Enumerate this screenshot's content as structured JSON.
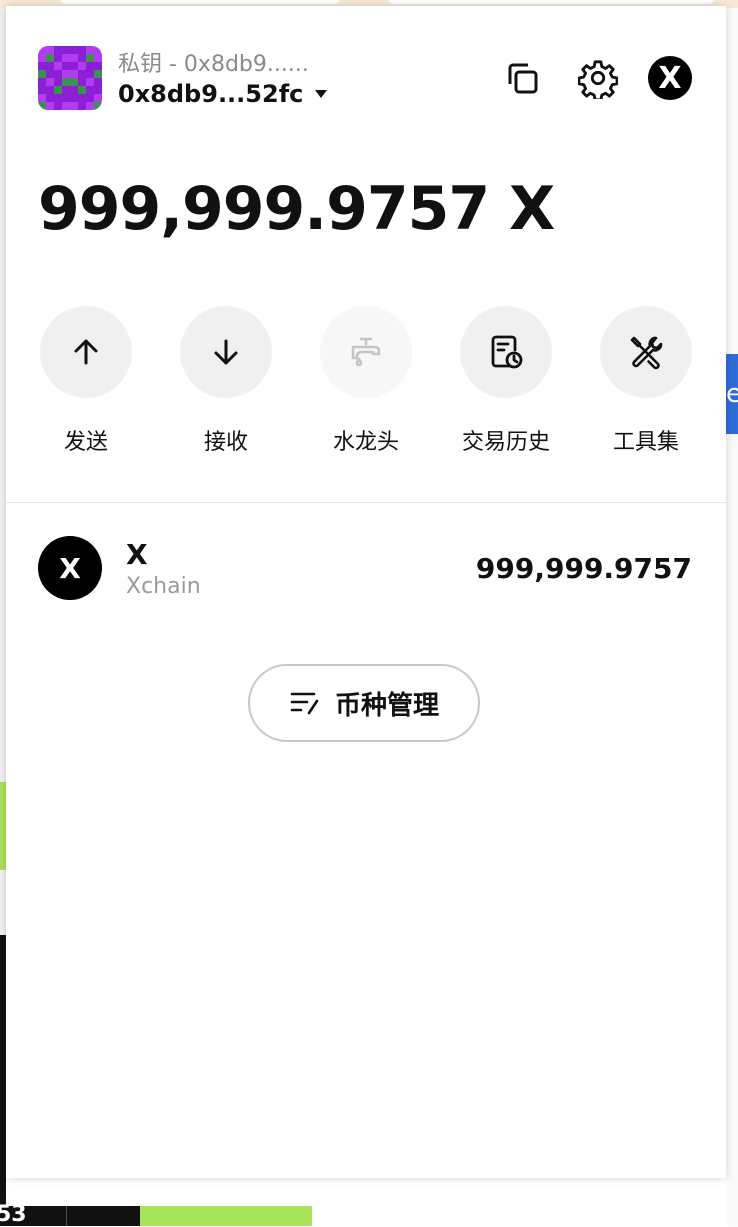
{
  "account": {
    "subtitle": "私钥 - 0x8db9......",
    "address": "0x8db9...52fc"
  },
  "header_icons": [
    "copy-icon",
    "gear-icon",
    "x-logo-icon"
  ],
  "logo_letter": "X",
  "balance": {
    "text": "999,999.9757 X"
  },
  "actions": [
    {
      "label": "发送",
      "icon": "arrow-up-icon"
    },
    {
      "label": "接收",
      "icon": "arrow-down-icon"
    },
    {
      "label": "水龙头",
      "icon": "faucet-icon"
    },
    {
      "label": "交易历史",
      "icon": "history-icon"
    },
    {
      "label": "工具集",
      "icon": "tools-icon"
    }
  ],
  "tokens": [
    {
      "icon_letter": "X",
      "symbol": "X",
      "chain": "Xchain",
      "amount": "999,999.9757"
    }
  ],
  "manage_button": {
    "label": "币种管理",
    "icon": "edit-list-icon"
  },
  "background": {
    "bottom_text": "53",
    "right_text": "e"
  },
  "colors": {
    "avatar_purple": "#8a1fd6",
    "avatar_magenta": "#b23cf0",
    "avatar_green": "#3f8f55",
    "accent_black": "#000000",
    "action_bg": "#f0f0f0",
    "bg_green": "#a8e35a",
    "bg_blue": "#2f6bd8"
  }
}
